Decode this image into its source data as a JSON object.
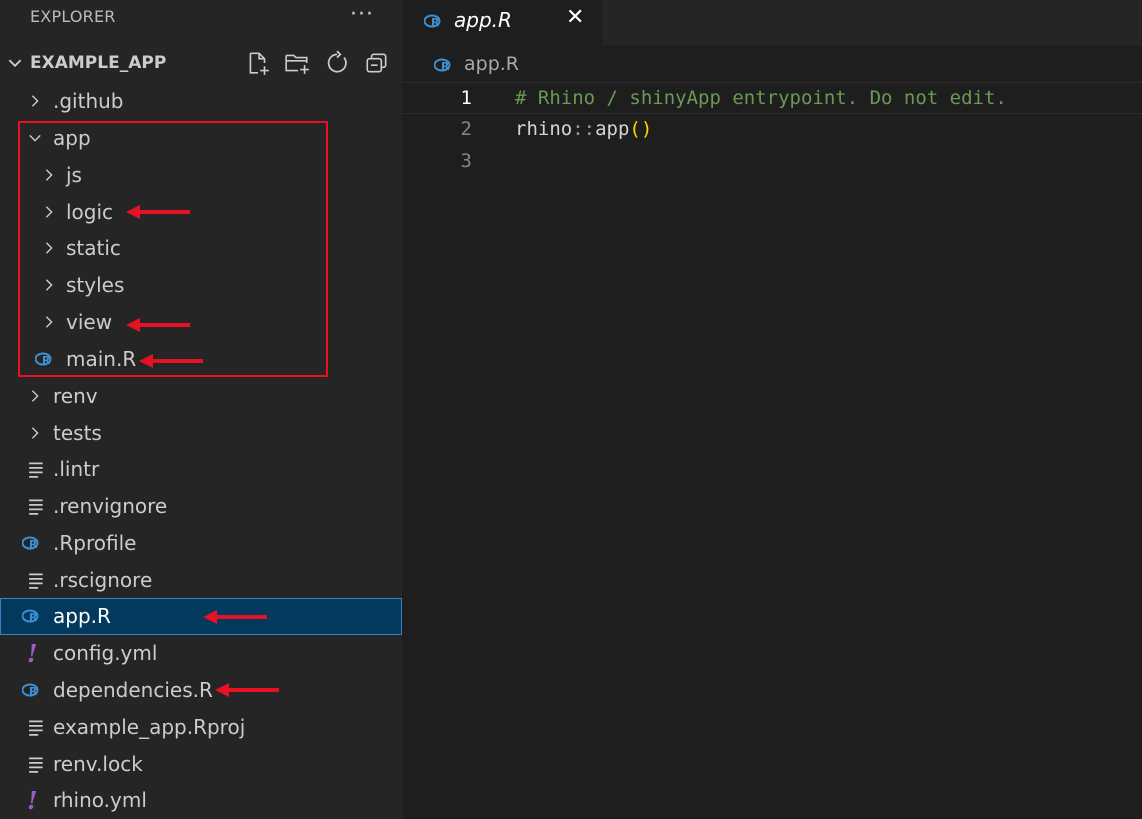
{
  "explorer": {
    "title": "EXPLORER",
    "more_actions": "···",
    "section": {
      "title": "EXAMPLE_APP",
      "actions": [
        "new-file-icon",
        "new-folder-icon",
        "refresh-icon",
        "collapse-all-icon"
      ]
    },
    "tree": [
      {
        "label": ".github",
        "kind": "folder",
        "expanded": false
      },
      {
        "label": "app",
        "kind": "folder",
        "expanded": true
      },
      {
        "label": "js",
        "kind": "folder",
        "expanded": false
      },
      {
        "label": "logic",
        "kind": "folder",
        "expanded": false
      },
      {
        "label": "static",
        "kind": "folder",
        "expanded": false
      },
      {
        "label": "styles",
        "kind": "folder",
        "expanded": false
      },
      {
        "label": "view",
        "kind": "folder",
        "expanded": false
      },
      {
        "label": "main.R",
        "kind": "r-file"
      },
      {
        "label": "renv",
        "kind": "folder",
        "expanded": false
      },
      {
        "label": "tests",
        "kind": "folder",
        "expanded": false
      },
      {
        "label": ".lintr",
        "kind": "text-file"
      },
      {
        "label": ".renvignore",
        "kind": "text-file"
      },
      {
        "label": ".Rprofile",
        "kind": "r-file"
      },
      {
        "label": ".rscignore",
        "kind": "text-file"
      },
      {
        "label": "app.R",
        "kind": "r-file",
        "selected": true
      },
      {
        "label": "config.yml",
        "kind": "yaml-file"
      },
      {
        "label": "dependencies.R",
        "kind": "r-file"
      },
      {
        "label": "example_app.Rproj",
        "kind": "text-file"
      },
      {
        "label": "renv.lock",
        "kind": "text-file"
      },
      {
        "label": "rhino.yml",
        "kind": "yaml-file"
      }
    ]
  },
  "editor": {
    "tab": {
      "label": "app.R",
      "close": "✕"
    },
    "breadcrumb": "app.R",
    "lines": [
      {
        "number": "1",
        "tokens": [
          {
            "t": "# Rhino / shinyApp entrypoint. Do not edit.",
            "c": "comment"
          }
        ]
      },
      {
        "number": "2",
        "tokens": [
          {
            "t": "rhino",
            "c": "default"
          },
          {
            "t": "::",
            "c": "op"
          },
          {
            "t": "app",
            "c": "default"
          },
          {
            "t": "()",
            "c": "paren"
          }
        ]
      },
      {
        "number": "3",
        "tokens": []
      }
    ]
  },
  "colors": {
    "annotation": "#e81123",
    "selection": "#04395e",
    "r_icon": "#3d8fd1",
    "yaml_icon": "#9d5cc7"
  }
}
